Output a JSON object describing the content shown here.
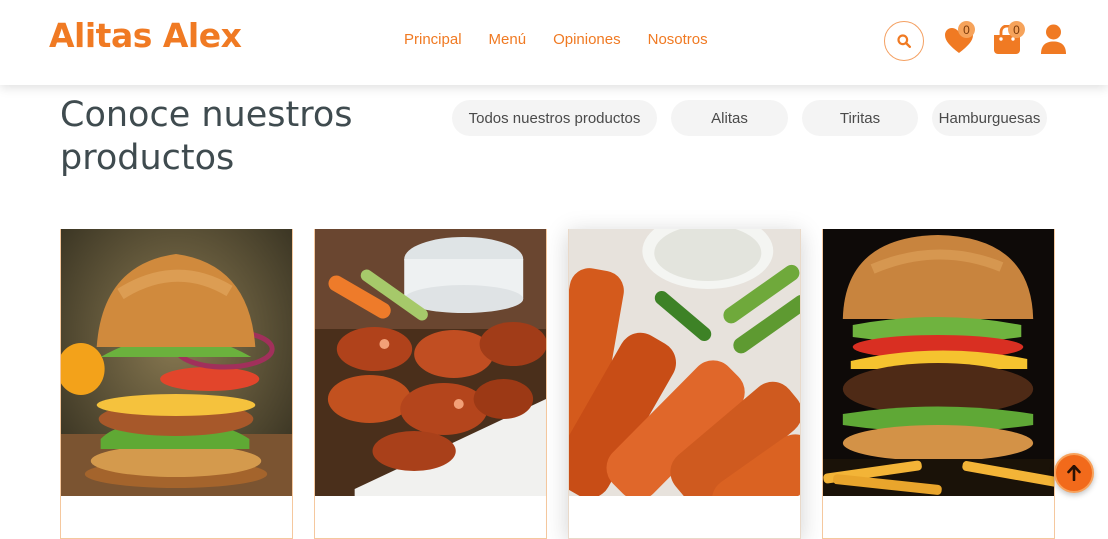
{
  "brand": {
    "name": "Alitas Alex",
    "accent_color": "#f07a23"
  },
  "nav": {
    "items": [
      {
        "label": "Principal"
      },
      {
        "label": "Menú"
      },
      {
        "label": "Opiniones"
      },
      {
        "label": "Nosotros"
      }
    ]
  },
  "header_actions": {
    "search_icon": "search-icon",
    "favorites": {
      "icon": "heart-icon",
      "count": "0"
    },
    "cart": {
      "icon": "shopping-bag-icon",
      "count": "0"
    },
    "account_icon": "user-icon"
  },
  "section": {
    "title": "Conoce nuestros productos"
  },
  "filters": [
    {
      "label": "Todos nuestros productos"
    },
    {
      "label": "Alitas"
    },
    {
      "label": "Tiritas"
    },
    {
      "label": "Hamburguesas"
    }
  ],
  "products": [
    {
      "image": "burger-with-onion-and-cheese"
    },
    {
      "image": "glazed-chicken-wings-with-dip"
    },
    {
      "image": "breaded-chicken-strips-with-dip"
    },
    {
      "image": "cheeseburger-with-fries"
    }
  ],
  "scroll_top_icon": "arrow-up-icon"
}
